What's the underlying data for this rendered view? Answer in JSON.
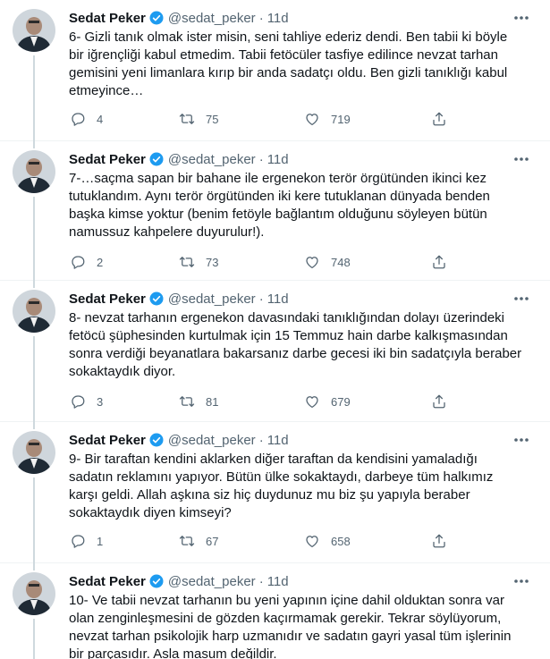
{
  "tweets": [
    {
      "name": "Sedat Peker",
      "handle": "@sedat_peker",
      "dot": "·",
      "time": "11d",
      "text": "6- Gizli tanık olmak ister misin, seni tahliye ederiz dendi. Ben tabii ki böyle\nbir iğrençliği kabul etmedim. Tabii fetöcüler tasfiye edilince nevzat tarhan\ngemisini yeni limanlara kırıp bir anda sadatçı oldu. Ben gizli tanıklığı kabul\netmeyince…",
      "replies": "4",
      "retweets": "75",
      "likes": "719"
    },
    {
      "name": "Sedat Peker",
      "handle": "@sedat_peker",
      "dot": "·",
      "time": "11d",
      "text": "7-…saçma sapan bir bahane ile ergenekon terör örgütünden ikinci kez\ntutuklandım. Aynı terör örgütünden iki kere tutuklanan dünyada benden\nbaşka kimse yoktur (benim fetöyle bağlantım olduğunu söyleyen bütün\nnamussuz kahpelere duyurulur!).",
      "replies": "2",
      "retweets": "73",
      "likes": "748"
    },
    {
      "name": "Sedat Peker",
      "handle": "@sedat_peker",
      "dot": "·",
      "time": "11d",
      "text": "8- nevzat tarhanın ergenekon davasındaki tanıklığından dolayı üzerindeki\nfetöcü şüphesinden kurtulmak için 15 Temmuz hain darbe kalkışmasından\nsonra verdiği beyanatlara bakarsanız darbe gecesi iki bin sadatçıyla beraber\nsokaktaydık diyor.",
      "replies": "3",
      "retweets": "81",
      "likes": "679"
    },
    {
      "name": "Sedat Peker",
      "handle": "@sedat_peker",
      "dot": "·",
      "time": "11d",
      "text": "9- Bir taraftan kendini aklarken diğer taraftan da kendisini yamaladığı\nsadatın reklamını yapıyor. Bütün ülke sokaktaydı, darbeye tüm halkımız\nkarşı geldi. Allah aşkına siz hiç duydunuz mu biz şu yapıyla beraber\nsokaktaydık diyen kimseyi?",
      "replies": "1",
      "retweets": "67",
      "likes": "658"
    },
    {
      "name": "Sedat Peker",
      "handle": "@sedat_peker",
      "dot": "·",
      "time": "11d",
      "text": "10- Ve tabii nevzat tarhanın bu yeni yapının içine dahil olduktan sonra var\nolan zenginleşmesini de gözden kaçırmamak gerekir. Tekrar söylüyorum,\nnevzat tarhan psikolojik harp uzmanıdır ve sadatın gayri yasal tüm işlerinin\nbir parçasıdır. Asla masum değildir."
    }
  ],
  "colors": {
    "text": "#0f1419",
    "secondary": "#536471",
    "verified": "#1d9bf0",
    "thread_line": "#cfd9de",
    "divider": "#eff3f4"
  },
  "icons": [
    "avatar",
    "verified-badge-icon",
    "more-icon",
    "reply-icon",
    "retweet-icon",
    "like-icon",
    "share-icon"
  ]
}
